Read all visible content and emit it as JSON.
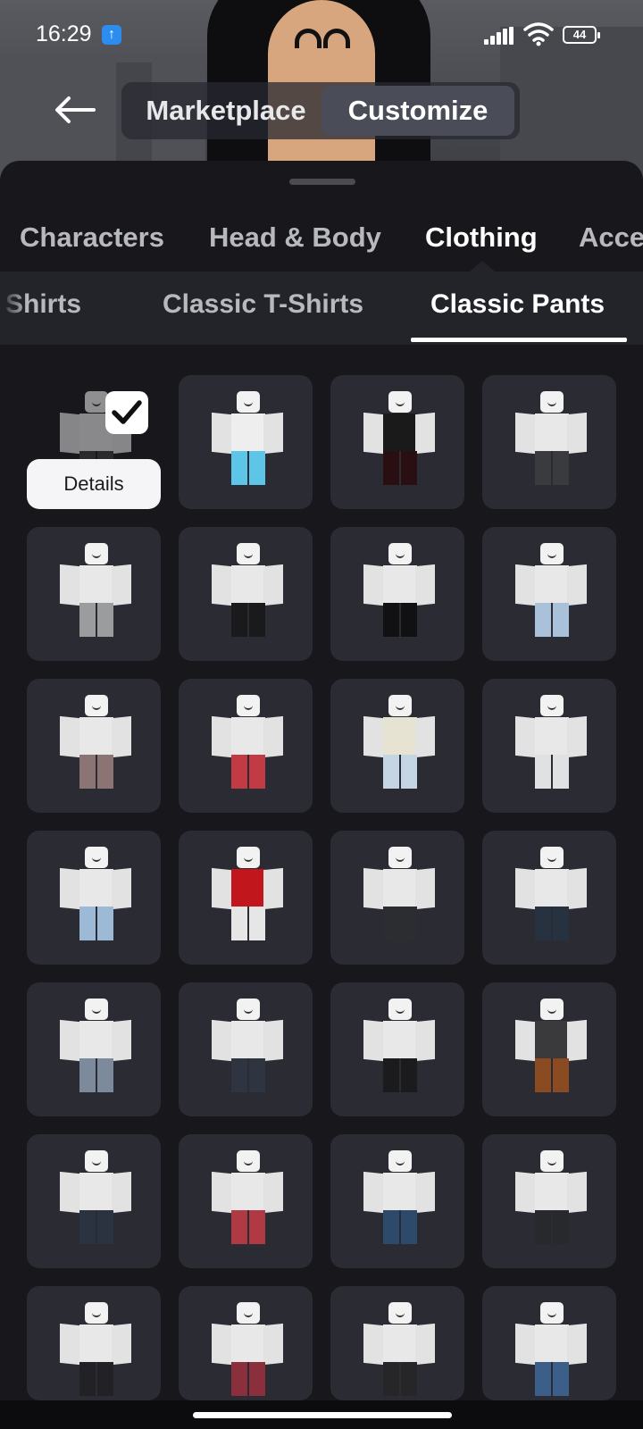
{
  "status_bar": {
    "time": "16:29",
    "battery": "44"
  },
  "header": {
    "tabs": [
      {
        "label": "Marketplace"
      },
      {
        "label": "Customize"
      }
    ]
  },
  "categories": [
    {
      "label": "Characters"
    },
    {
      "label": "Head & Body"
    },
    {
      "label": "Clothing"
    },
    {
      "label": "Acce"
    }
  ],
  "subcategories": [
    {
      "label": "Shirts"
    },
    {
      "label": "Classic T-Shirts"
    },
    {
      "label": "Classic Pants"
    }
  ],
  "selected_item": {
    "details_label": "Details"
  },
  "items": [
    {
      "top": "#e8e8e8",
      "pants": "#3a3b3e"
    },
    {
      "top": "#eeeeee",
      "pants": "#5dc5e8"
    },
    {
      "top": "#1a1a1a",
      "pants": "#2a0f12"
    },
    {
      "top": "#e8e8e8",
      "pants": "#3a3b3e"
    },
    {
      "top": "#e8e8e8",
      "pants": "#9b9c9e"
    },
    {
      "top": "#e8e8e8",
      "pants": "#1a1a1c"
    },
    {
      "top": "#e8e8e8",
      "pants": "#111113"
    },
    {
      "top": "#e8e8e8",
      "pants": "#a9c2d9"
    },
    {
      "top": "#e8e8e8",
      "pants": "#8c7474"
    },
    {
      "top": "#e8e8e8",
      "pants": "#c23a44"
    },
    {
      "top": "#e6e3d3",
      "pants": "#c6d5e3"
    },
    {
      "top": "#e8e8e8",
      "pants": "#dfe1e3"
    },
    {
      "top": "#e8e8e8",
      "pants": "#9cb9d6"
    },
    {
      "top": "#c0161c",
      "pants": "#e6e6e6"
    },
    {
      "top": "#e8e8e8",
      "pants": "#2c2d31"
    },
    {
      "top": "#e8e8e8",
      "pants": "#26323f"
    },
    {
      "top": "#e8e8e8",
      "pants": "#7c8a9c"
    },
    {
      "top": "#e8e8e8",
      "pants": "#2f3540"
    },
    {
      "top": "#e8e8e8",
      "pants": "#1b1b1d"
    },
    {
      "top": "#3a3a3c",
      "pants": "#8a4a22"
    },
    {
      "top": "#e8e8e8",
      "pants": "#2c3340"
    },
    {
      "top": "#e8e8e8",
      "pants": "#b03a44"
    },
    {
      "top": "#e8e8e8",
      "pants": "#2d4a6a"
    },
    {
      "top": "#e8e8e8",
      "pants": "#28292c"
    },
    {
      "top": "#e8e8e8",
      "pants": "#222226"
    },
    {
      "top": "#e8e8e8",
      "pants": "#8b2f3d"
    },
    {
      "top": "#e8e8e8",
      "pants": "#262628"
    },
    {
      "top": "#e8e8e8",
      "pants": "#3c5f8a"
    }
  ]
}
